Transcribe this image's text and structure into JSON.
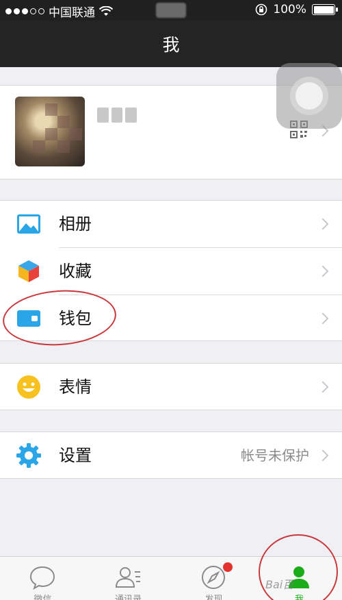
{
  "status_bar": {
    "carrier": "中国联通",
    "battery_text": "100%",
    "signal_filled": 3,
    "signal_total": 5
  },
  "nav": {
    "title": "我"
  },
  "menu": {
    "album": {
      "label": "相册",
      "icon": "album-icon"
    },
    "favorites": {
      "label": "收藏",
      "icon": "favorites-icon"
    },
    "wallet": {
      "label": "钱包",
      "icon": "wallet-icon"
    },
    "stickers": {
      "label": "表情",
      "icon": "sticker-icon"
    },
    "settings": {
      "label": "设置",
      "value": "帐号未保护",
      "icon": "settings-icon"
    }
  },
  "tabs": [
    {
      "label": "微信",
      "icon": "chat-bubble-icon",
      "active": false
    },
    {
      "label": "通讯录",
      "icon": "contacts-icon",
      "active": false
    },
    {
      "label": "发现",
      "icon": "compass-icon",
      "active": false,
      "badge": true
    },
    {
      "label": "我",
      "icon": "person-icon",
      "active": true
    }
  ],
  "watermark": "Bai百",
  "colors": {
    "nav_bg": "#242424",
    "accent_green": "#1aad19",
    "badge_red": "#e2322d",
    "annotation_red": "#c8383c",
    "page_bg": "#efeff4"
  }
}
